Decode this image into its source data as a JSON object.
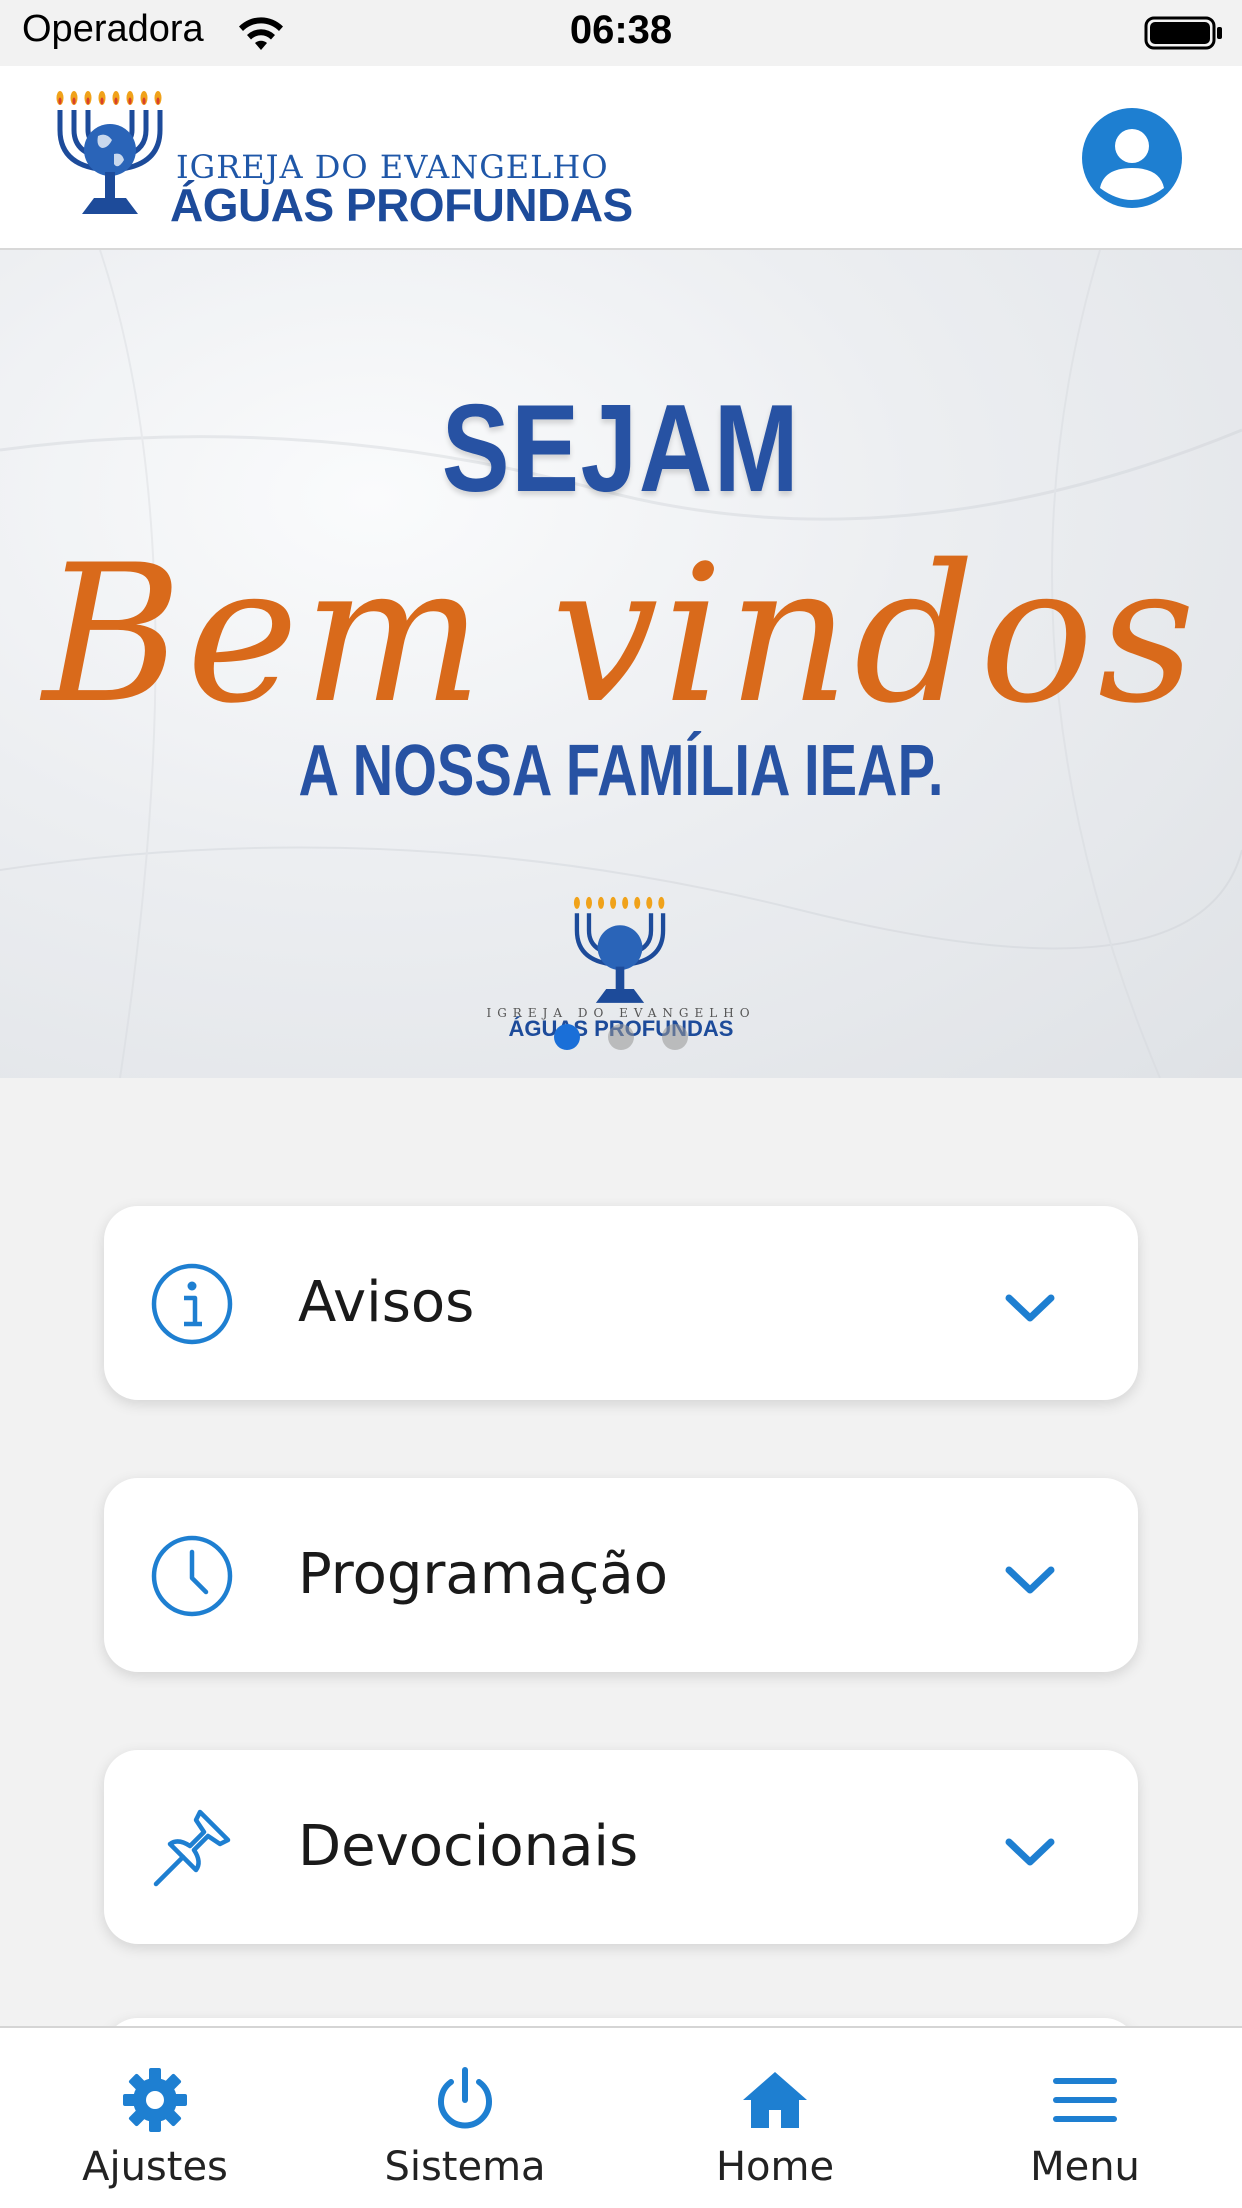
{
  "status_bar": {
    "carrier": "Operadora",
    "time": "06:38"
  },
  "header": {
    "logo_line1": "IGREJA DO EVANGELHO",
    "logo_line2": "ÁGUAS PROFUNDAS",
    "profile_icon": "account-circle-icon"
  },
  "banner": {
    "title": "SEJAM",
    "script": "Bem vindos",
    "subtitle": "A NOSSA FAMÍLIA IEAP.",
    "logo_line1": "IGREJA DO EVANGELHO",
    "logo_line2": "ÁGUAS PROFUNDAS",
    "pager": {
      "count": 3,
      "active_index": 0
    }
  },
  "sections": [
    {
      "label": "Avisos",
      "icon": "info-icon"
    },
    {
      "label": "Programação",
      "icon": "clock-icon"
    },
    {
      "label": "Devocionais",
      "icon": "pushpin-icon"
    }
  ],
  "tab_bar": [
    {
      "label": "Ajustes",
      "icon": "gear-icon"
    },
    {
      "label": "Sistema",
      "icon": "power-icon"
    },
    {
      "label": "Home",
      "icon": "home-icon"
    },
    {
      "label": "Menu",
      "icon": "menu-icon"
    }
  ],
  "colors": {
    "accent": "#1e7fd1",
    "brand_blue": "#2752a3",
    "brand_orange": "#d96a1b",
    "background": "#f2f2f2"
  }
}
